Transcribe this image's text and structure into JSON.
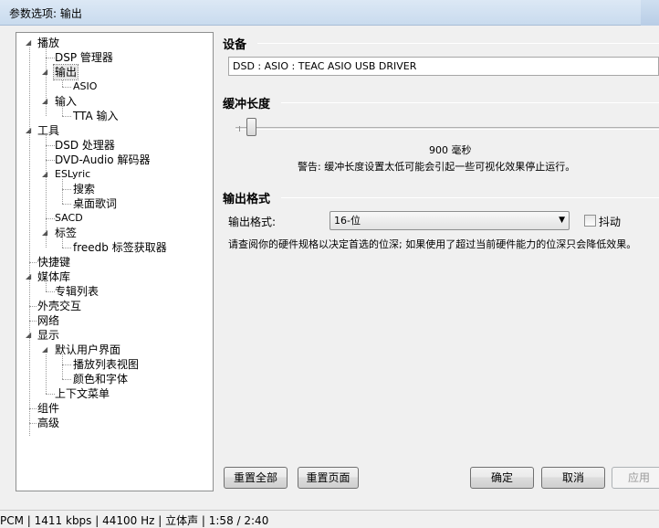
{
  "window": {
    "title": "参数选项: 输出"
  },
  "tree": {
    "items": [
      {
        "label": "播放"
      },
      {
        "label": "DSP 管理器"
      },
      {
        "label": "输出"
      },
      {
        "label": "ASIO"
      },
      {
        "label": "输入"
      },
      {
        "label": "TTA 输入"
      },
      {
        "label": "工具"
      },
      {
        "label": "DSD 处理器"
      },
      {
        "label": "DVD-Audio 解码器"
      },
      {
        "label": "ESLyric"
      },
      {
        "label": "搜索"
      },
      {
        "label": "桌面歌词"
      },
      {
        "label": "SACD"
      },
      {
        "label": "标签"
      },
      {
        "label": "freedb 标签获取器"
      },
      {
        "label": "快捷键"
      },
      {
        "label": "媒体库"
      },
      {
        "label": "专辑列表"
      },
      {
        "label": "外壳交互"
      },
      {
        "label": "网络"
      },
      {
        "label": "显示"
      },
      {
        "label": "默认用户界面"
      },
      {
        "label": "播放列表视图"
      },
      {
        "label": "颜色和字体"
      },
      {
        "label": "上下文菜单"
      },
      {
        "label": "组件"
      },
      {
        "label": "高级"
      }
    ]
  },
  "device": {
    "title": "设备",
    "selected": "DSD : ASIO : TEAC ASIO USB DRIVER"
  },
  "buffer": {
    "title": "缓冲长度",
    "value_text": "900 毫秒",
    "warning": "警告: 缓冲长度设置太低可能会引起一些可视化效果停止运行。"
  },
  "format": {
    "title": "输出格式",
    "label": "输出格式:",
    "selected": "16-位",
    "dither_label": "抖动",
    "dither_checked": false,
    "description": "请查阅你的硬件规格以决定首选的位深; 如果使用了超过当前硬件能力的位深只会降低效果。"
  },
  "buttons": {
    "reset_all": "重置全部",
    "reset_page": "重置页面",
    "ok": "确定",
    "cancel": "取消",
    "apply": "应用"
  },
  "status": "PCM | 1411 kbps | 44100 Hz | 立体声 | 1:58 / 2:40"
}
